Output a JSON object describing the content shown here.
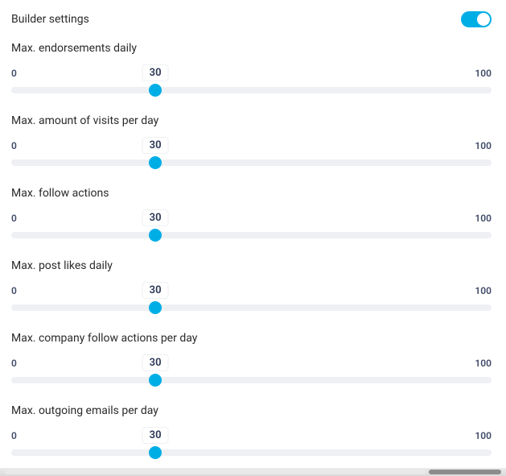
{
  "header": {
    "title": "Builder settings",
    "toggle_on": true
  },
  "sliders": [
    {
      "label": "Max. endorsements daily",
      "min": 0,
      "max": 100,
      "value": 30
    },
    {
      "label": "Max. amount of visits per day",
      "min": 0,
      "max": 100,
      "value": 30
    },
    {
      "label": "Max. follow actions",
      "min": 0,
      "max": 100,
      "value": 30
    },
    {
      "label": "Max. post likes daily",
      "min": 0,
      "max": 100,
      "value": 30
    },
    {
      "label": "Max. company follow actions per day",
      "min": 0,
      "max": 100,
      "value": 30
    },
    {
      "label": "Max. outgoing emails per day",
      "min": 0,
      "max": 100,
      "value": 30
    }
  ]
}
